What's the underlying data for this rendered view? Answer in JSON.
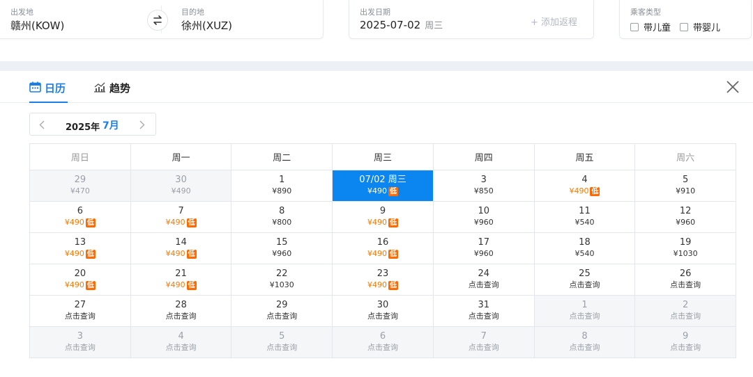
{
  "search": {
    "origin_label": "出发地",
    "origin_value": "赣州(KOW)",
    "dest_label": "目的地",
    "dest_value": "徐州(XUZ)",
    "date_label": "出发日期",
    "date_value": "2025-07-02",
    "date_weekday": "周三",
    "add_return": "+ 添加返程",
    "pax_label": "乘客类型",
    "pax_child": "带儿童",
    "pax_infant": "带婴儿"
  },
  "tabs": [
    {
      "label": "日历",
      "icon": "calendar-icon",
      "active": true
    },
    {
      "label": "趋势",
      "icon": "trend-chart-icon",
      "active": false
    }
  ],
  "month_nav": {
    "year": "2025年",
    "month": "7月"
  },
  "weekdays": [
    "周日",
    "周一",
    "周二",
    "周三",
    "周四",
    "周五",
    "周六"
  ],
  "colors": {
    "accent": "#1a7ee6",
    "selected_bg": "#0b86f0",
    "low_price": "#ff7700",
    "low_badge": "#ff6a00"
  },
  "low_badge_text": "低",
  "weeks": [
    [
      {
        "day": "29",
        "sub": "¥470",
        "muted": true
      },
      {
        "day": "30",
        "sub": "¥490",
        "muted": true
      },
      {
        "day": "1",
        "sub": "¥890"
      },
      {
        "day": "07/02 周三",
        "sub": "¥490",
        "low": true,
        "selected": true
      },
      {
        "day": "3",
        "sub": "¥850"
      },
      {
        "day": "4",
        "sub": "¥490",
        "low": true
      },
      {
        "day": "5",
        "sub": "¥910"
      }
    ],
    [
      {
        "day": "6",
        "sub": "¥490",
        "low": true
      },
      {
        "day": "7",
        "sub": "¥490",
        "low": true
      },
      {
        "day": "8",
        "sub": "¥800"
      },
      {
        "day": "9",
        "sub": "¥490",
        "low": true
      },
      {
        "day": "10",
        "sub": "¥960"
      },
      {
        "day": "11",
        "sub": "¥540"
      },
      {
        "day": "12",
        "sub": "¥960"
      }
    ],
    [
      {
        "day": "13",
        "sub": "¥490",
        "low": true
      },
      {
        "day": "14",
        "sub": "¥490",
        "low": true
      },
      {
        "day": "15",
        "sub": "¥960"
      },
      {
        "day": "16",
        "sub": "¥490",
        "low": true
      },
      {
        "day": "17",
        "sub": "¥960"
      },
      {
        "day": "18",
        "sub": "¥540"
      },
      {
        "day": "19",
        "sub": "¥1030"
      }
    ],
    [
      {
        "day": "20",
        "sub": "¥490",
        "low": true
      },
      {
        "day": "21",
        "sub": "¥490",
        "low": true
      },
      {
        "day": "22",
        "sub": "¥1030"
      },
      {
        "day": "23",
        "sub": "¥490",
        "low": true
      },
      {
        "day": "24",
        "sub": "点击查询",
        "query": true
      },
      {
        "day": "25",
        "sub": "点击查询",
        "query": true
      },
      {
        "day": "26",
        "sub": "点击查询",
        "query": true
      }
    ],
    [
      {
        "day": "27",
        "sub": "点击查询",
        "query": true
      },
      {
        "day": "28",
        "sub": "点击查询",
        "query": true
      },
      {
        "day": "29",
        "sub": "点击查询",
        "query": true
      },
      {
        "day": "30",
        "sub": "点击查询",
        "query": true
      },
      {
        "day": "31",
        "sub": "点击查询",
        "query": true
      },
      {
        "day": "1",
        "sub": "点击查询",
        "query": true,
        "muted": true
      },
      {
        "day": "2",
        "sub": "点击查询",
        "query": true,
        "muted": true
      }
    ],
    [
      {
        "day": "3",
        "sub": "点击查询",
        "query": true,
        "muted": true
      },
      {
        "day": "4",
        "sub": "点击查询",
        "query": true,
        "muted": true
      },
      {
        "day": "5",
        "sub": "点击查询",
        "query": true,
        "muted": true
      },
      {
        "day": "6",
        "sub": "点击查询",
        "query": true,
        "muted": true
      },
      {
        "day": "7",
        "sub": "点击查询",
        "query": true,
        "muted": true
      },
      {
        "day": "8",
        "sub": "点击查询",
        "query": true,
        "muted": true
      },
      {
        "day": "9",
        "sub": "点击查询",
        "query": true,
        "muted": true
      }
    ]
  ]
}
